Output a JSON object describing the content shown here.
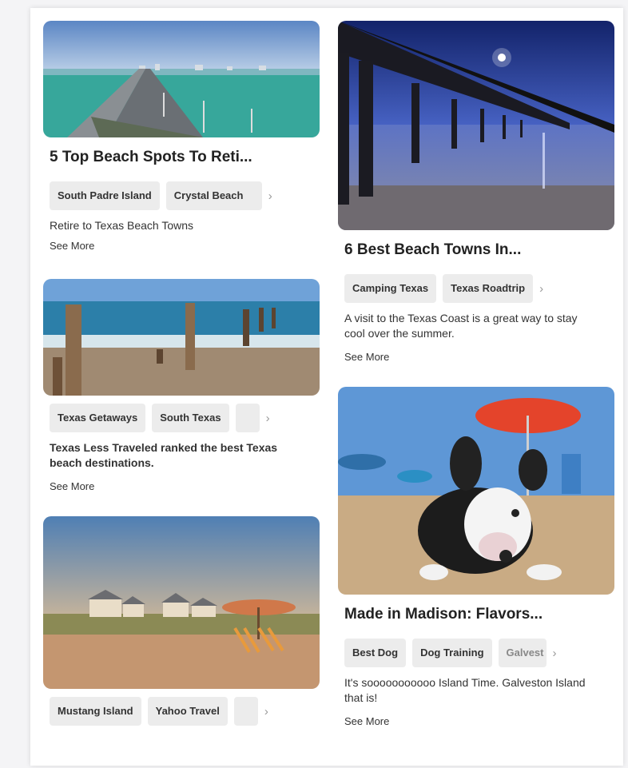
{
  "cards_left": [
    {
      "title": "5 Top Beach Spots To Reti...",
      "tags": [
        "South Padre Island",
        "Crystal Beach"
      ],
      "description": "Retire to Texas Beach Towns",
      "more": "See More"
    },
    {
      "tags": [
        "Texas Getaways",
        "South Texas"
      ],
      "description": "Texas Less Traveled ranked the best Texas beach destinations.",
      "more": "See More"
    },
    {
      "tags": [
        "Mustang Island",
        "Yahoo Travel"
      ]
    }
  ],
  "cards_right": [
    {
      "title": "6 Best Beach Towns In...",
      "tags": [
        "Camping Texas",
        "Texas Roadtrip"
      ],
      "description": "A visit to the Texas Coast is a great way to stay cool over the summer.",
      "more": "See More"
    },
    {
      "title": "Made in Madison: Flavors...",
      "tags": [
        "Best Dog",
        "Dog Training",
        "Galvest"
      ],
      "description": "It's sooooooooooo Island Time. Galveston Island that is!",
      "more": "See More"
    }
  ],
  "icons": {
    "chevron": "chevron-right-icon"
  },
  "colors": {
    "sky": "#4a86c6",
    "sea": "#3ba6a0",
    "sand": "#cfae86",
    "night": "#1b2a6b"
  }
}
